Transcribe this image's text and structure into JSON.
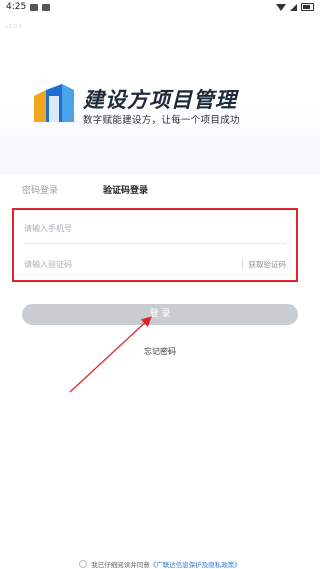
{
  "status_bar": {
    "time": "4:25"
  },
  "hero": {
    "corner_text": "v1.0.0",
    "title": "建设方项目管理",
    "subtitle": "数字赋能建设方，让每一个项目成功"
  },
  "tabs": {
    "password_login": "密码登录",
    "code_login": "验证码登录"
  },
  "form": {
    "phone_placeholder": "请输入手机号",
    "code_placeholder": "请输入验证码",
    "get_code": "获取验证码"
  },
  "login_button": "登 录",
  "forgot_password": "忘记密码",
  "agreement": {
    "prefix": "我已仔细阅读并同意",
    "link": "《广联达信息保护及隐私政策》"
  },
  "colors": {
    "highlight": "#e0262b",
    "accent": "#2d79d6",
    "button": "#c9cdd2"
  }
}
